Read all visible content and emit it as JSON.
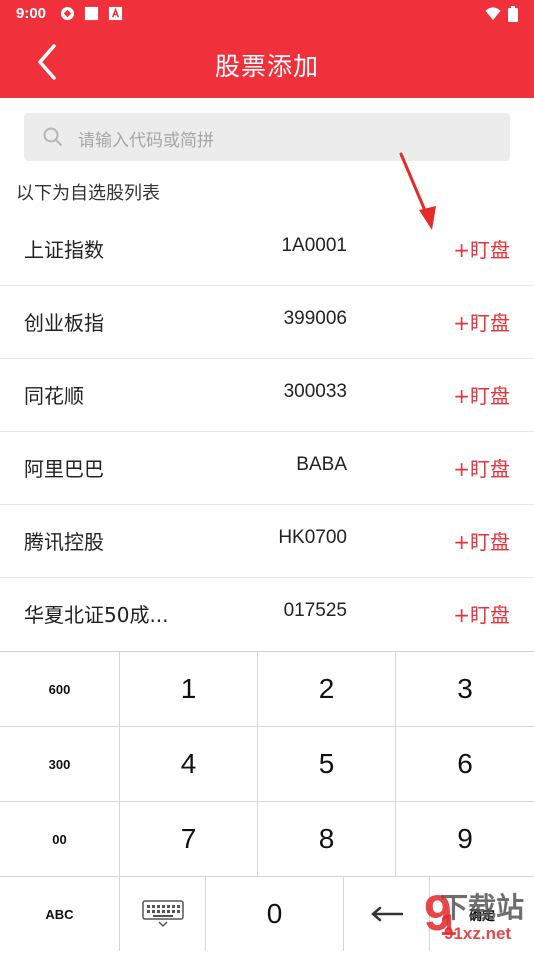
{
  "status_bar": {
    "time": "9:00"
  },
  "header": {
    "title": "股票添加"
  },
  "search": {
    "placeholder": "请输入代码或简拼"
  },
  "list": {
    "label": "以下为自选股列表",
    "items": [
      {
        "name": "上证指数",
        "code": "1A0001",
        "action": "+盯盘"
      },
      {
        "name": "创业板指",
        "code": "399006",
        "action": "+盯盘"
      },
      {
        "name": "同花顺",
        "code": "300033",
        "action": "+盯盘"
      },
      {
        "name": "阿里巴巴",
        "code": "BABA",
        "action": "+盯盘"
      },
      {
        "name": "腾讯控股",
        "code": "HK0700",
        "action": "+盯盘"
      },
      {
        "name": "华夏北证50成...",
        "code": "017525",
        "action": "+盯盘"
      }
    ]
  },
  "keypad": {
    "side_keys": [
      "600",
      "300",
      "00",
      "ABC"
    ],
    "digits": [
      "1",
      "2",
      "3",
      "4",
      "5",
      "6",
      "7",
      "8",
      "9",
      "0"
    ],
    "confirm": "确定"
  },
  "watermark": {
    "brand": "下载站",
    "url": "91xz.net"
  },
  "colors": {
    "primary": "#f0303a",
    "accent": "#e8333a"
  }
}
